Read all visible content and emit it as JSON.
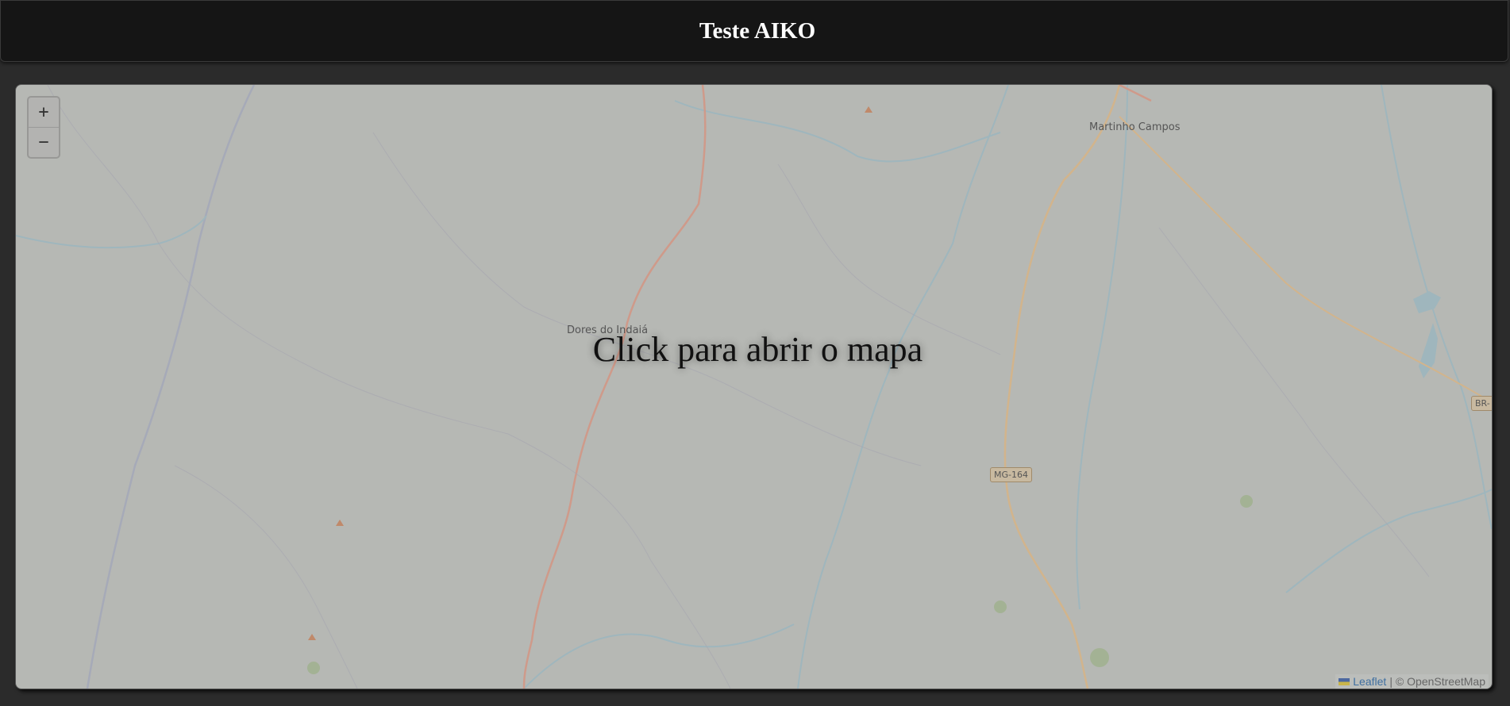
{
  "header": {
    "title": "Teste AIKO"
  },
  "map": {
    "overlay_text": "Click para abrir o mapa",
    "zoom_in_label": "+",
    "zoom_out_label": "−",
    "towns": {
      "dores": "Dores do Indaiá",
      "martinho": "Martinho Campos"
    },
    "road_shields": {
      "mg164": "MG-164",
      "br": "BR-"
    },
    "attribution": {
      "leaflet": "Leaflet",
      "separator": "|",
      "osm": "© OpenStreetMap"
    }
  }
}
